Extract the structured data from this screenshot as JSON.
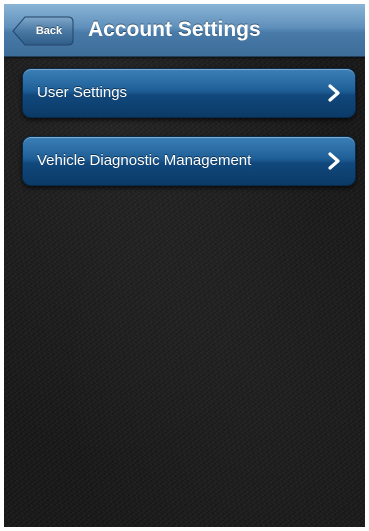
{
  "navbar": {
    "back_label": "Back",
    "title": "Account Settings"
  },
  "menu": {
    "items": [
      {
        "label": "User Settings",
        "icon": "chevron-right-icon"
      },
      {
        "label": "Vehicle Diagnostic Management",
        "icon": "chevron-right-icon"
      }
    ]
  },
  "colors": {
    "navbar": "#5f90bb",
    "button": "#1f5f97",
    "background": "#1a1a1a",
    "text": "#ffffff"
  }
}
